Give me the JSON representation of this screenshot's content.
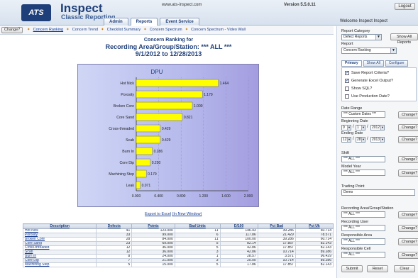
{
  "header": {
    "app_title": "Inspect",
    "app_subtitle": "Classic Reporting",
    "logo_text": "ATS",
    "site_url": "www.ats-inspect.com",
    "version": "Version 5.5.0.11",
    "logout_label": "Logout",
    "welcome": "Welcome Inspect Inspect",
    "tabs": [
      {
        "label": "Admin",
        "active": false
      },
      {
        "label": "Reports",
        "active": true
      },
      {
        "label": "Event Service",
        "active": false
      }
    ]
  },
  "breadcrumb": {
    "change_label": "Change?",
    "items": [
      {
        "label": "Concern Ranking",
        "active": true
      },
      {
        "label": "Concern Trend",
        "active": false
      },
      {
        "label": "Checklist Summary",
        "active": false
      },
      {
        "label": "Concern Spectrum",
        "active": false
      },
      {
        "label": "Concern Spectrum - Video Wall",
        "active": false
      }
    ]
  },
  "report": {
    "title_line1": "Concern Ranking for",
    "title_line2": "Recording Area/Group/Station: *** ALL ***",
    "title_line3": "9/1/2012 to 12/28/2013",
    "export_label": "Export to Excel",
    "new_window_label": "(In New Window)"
  },
  "chart_data": {
    "type": "bar",
    "orientation": "horizontal",
    "title": "DPU",
    "categories": [
      "Hot Nick",
      "Porosity",
      "Broken Core",
      "Core Sand",
      "Cross-threaded",
      "Scab",
      "Burn In",
      "Core Dip",
      "Machining Step",
      "Leak"
    ],
    "values": [
      1.464,
      1.179,
      1.0,
      0.821,
      0.429,
      0.429,
      0.286,
      0.25,
      0.179,
      0.071
    ],
    "value_labels": [
      "1.464",
      "1.179",
      "1.000",
      "0.821",
      "0.429",
      "0.429",
      "0.286",
      "0.250",
      "0.179",
      "0.071"
    ],
    "xlim": [
      0,
      2.0
    ],
    "xticks": [
      "0.000",
      "0.400",
      "0.800",
      "1.200",
      "1.600",
      "2.000"
    ],
    "bar_color": "#ffff00",
    "grid": true
  },
  "table": {
    "headers": [
      "Description",
      "Defects",
      "Points",
      "Bad Units",
      "D/100",
      "Pct Bad",
      "Pct Uk"
    ],
    "rows": [
      [
        "Hot Nick",
        "41",
        "123.000",
        "11",
        "146.43",
        "39.286",
        "60.714"
      ],
      [
        "Porosity",
        "33",
        "99.000",
        "6",
        "117.86",
        "21.429",
        "78.571"
      ],
      [
        "Broken Core",
        "28",
        "84.000",
        "11",
        "100.00",
        "39.286",
        "60.714"
      ],
      [
        "Core Sand",
        "23",
        "69.000",
        "5",
        "82.14",
        "17.857",
        "82.143"
      ],
      [
        "Cross-threaded",
        "12",
        "36.000",
        "5",
        "42.86",
        "17.857",
        "82.143"
      ],
      [
        "Scab",
        "12",
        "36.000",
        "3",
        "42.86",
        "10.714",
        "89.286"
      ],
      [
        "Burn In",
        "8",
        "24.000",
        "1",
        "28.57",
        "3.571",
        "96.429"
      ],
      [
        "Core Dip",
        "7",
        "21.000",
        "3",
        "25.00",
        "10.714",
        "89.286"
      ],
      [
        "Machining Step",
        "5",
        "15.000",
        "5",
        "17.86",
        "17.857",
        "82.143"
      ]
    ]
  },
  "panel": {
    "report_category_label": "Report Category",
    "report_category_value": "Defect Reports",
    "show_all_reports_label": "Show All Reports",
    "report_label": "Report",
    "report_value": "Concern Ranking",
    "tabs": [
      {
        "label": "Primary",
        "active": true
      },
      {
        "label": "Show All",
        "active": false
      },
      {
        "label": "Configure",
        "active": false
      }
    ],
    "options": [
      {
        "label": "Save Report Criteria?",
        "checked": true
      },
      {
        "label": "Generate Excel Output?",
        "checked": true
      },
      {
        "label": "Show SQL?",
        "checked": false
      },
      {
        "label": "Use Production Date?",
        "checked": false
      }
    ],
    "date_range_label": "Date Range",
    "date_range_value": "*** Custom Dates ***",
    "change_label": "Change?",
    "beginning_date_label": "Beginning Date",
    "begin_month": "9",
    "begin_day": "1",
    "begin_year": "2012",
    "ending_date_label": "Ending Date",
    "end_month": "12",
    "end_day": "28",
    "end_year": "2013",
    "shift_label": "Shift",
    "shift_value": "*** ALL ***",
    "model_year_label": "Model Year",
    "model_year_value": "*** ALL ***",
    "trading_point_label": "Trading Point",
    "trading_point_value": "Demo",
    "recording_area_label": "Recording Area/Group/Station",
    "recording_area_value": "*** ALL ***",
    "recording_user_label": "Recording User",
    "recording_user_value": "*** ALL ***",
    "responsible_area_label": "Responsible Area",
    "responsible_area_value": "*** ALL ***",
    "responsible_cell_label": "Responsible Cell",
    "responsible_cell_value": "*** ALL ***",
    "submit_label": "Submit",
    "reset_label": "Reset",
    "clear_label": "Clear"
  }
}
